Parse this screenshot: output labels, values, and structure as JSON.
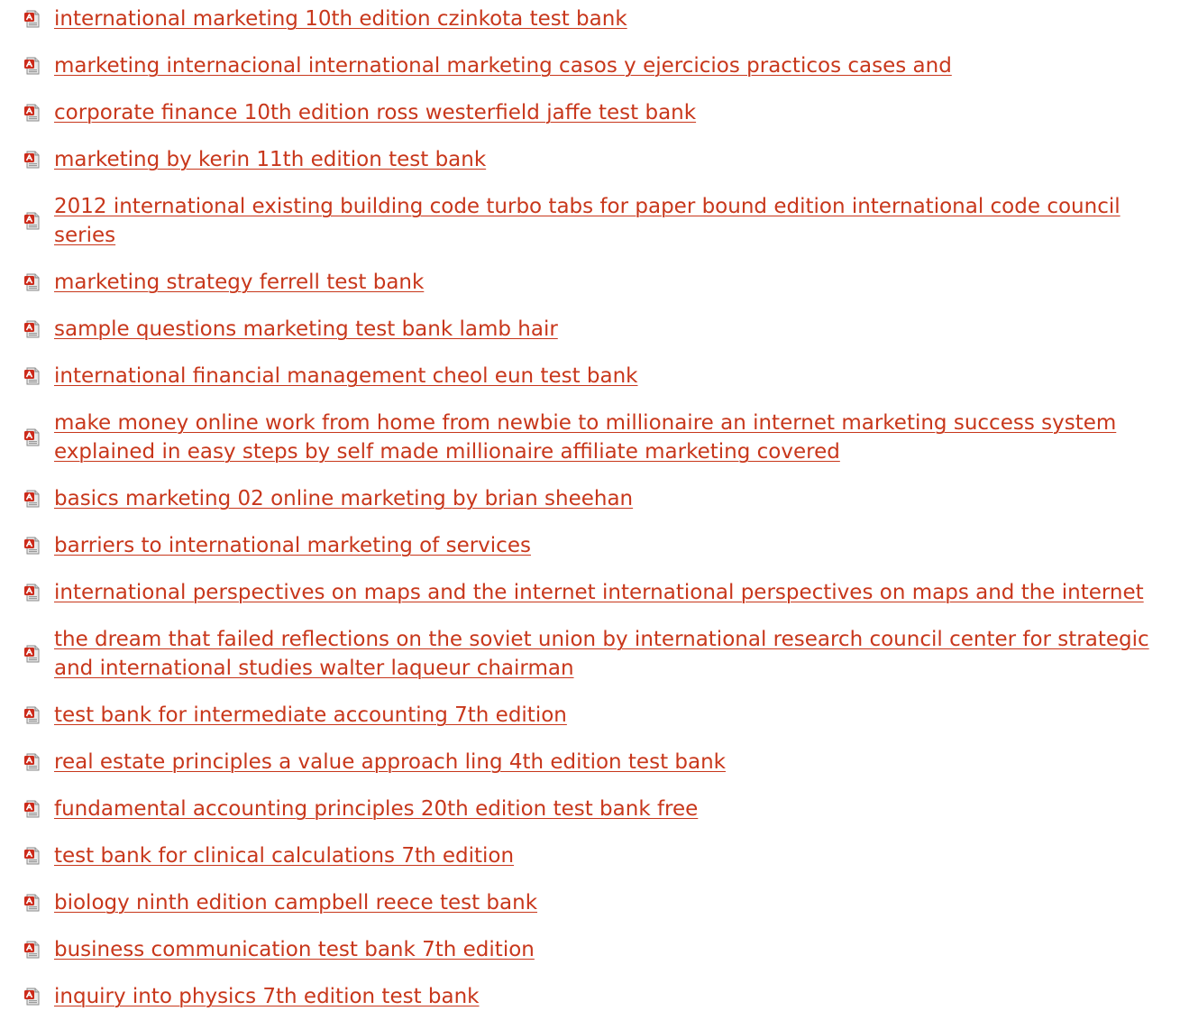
{
  "colors": {
    "link": "#c8371b",
    "icon_red": "#cc2a1a",
    "icon_paper": "#e8e8e8"
  },
  "icon_name": "pdf-file-icon",
  "links": [
    "international marketing 10th edition czinkota test bank",
    "marketing internacional international marketing casos y ejercicios practicos cases and",
    "corporate finance 10th edition ross westerfield jaffe test bank",
    "marketing by kerin 11th edition test bank",
    "2012 international existing building code turbo tabs for paper bound edition international code council series",
    "marketing strategy ferrell test bank",
    "sample questions marketing test bank lamb hair",
    "international financial management cheol eun test bank",
    "make money online work from home from newbie to millionaire an internet marketing success system explained in easy steps by self made millionaire affiliate marketing covered",
    "basics marketing 02 online marketing by brian sheehan",
    "barriers to international marketing of services",
    "international perspectives on maps and the internet international perspectives on maps and the internet",
    "the dream that failed reflections on the soviet union by international research council center for strategic and international studies walter laqueur chairman",
    "test bank for intermediate accounting 7th edition",
    "real estate principles a value approach ling 4th edition test bank",
    "fundamental accounting principles 20th edition test bank free",
    "test bank for clinical calculations 7th edition",
    "biology ninth edition campbell reece test bank",
    "business communication test bank 7th edition",
    "inquiry into physics 7th edition test bank"
  ]
}
